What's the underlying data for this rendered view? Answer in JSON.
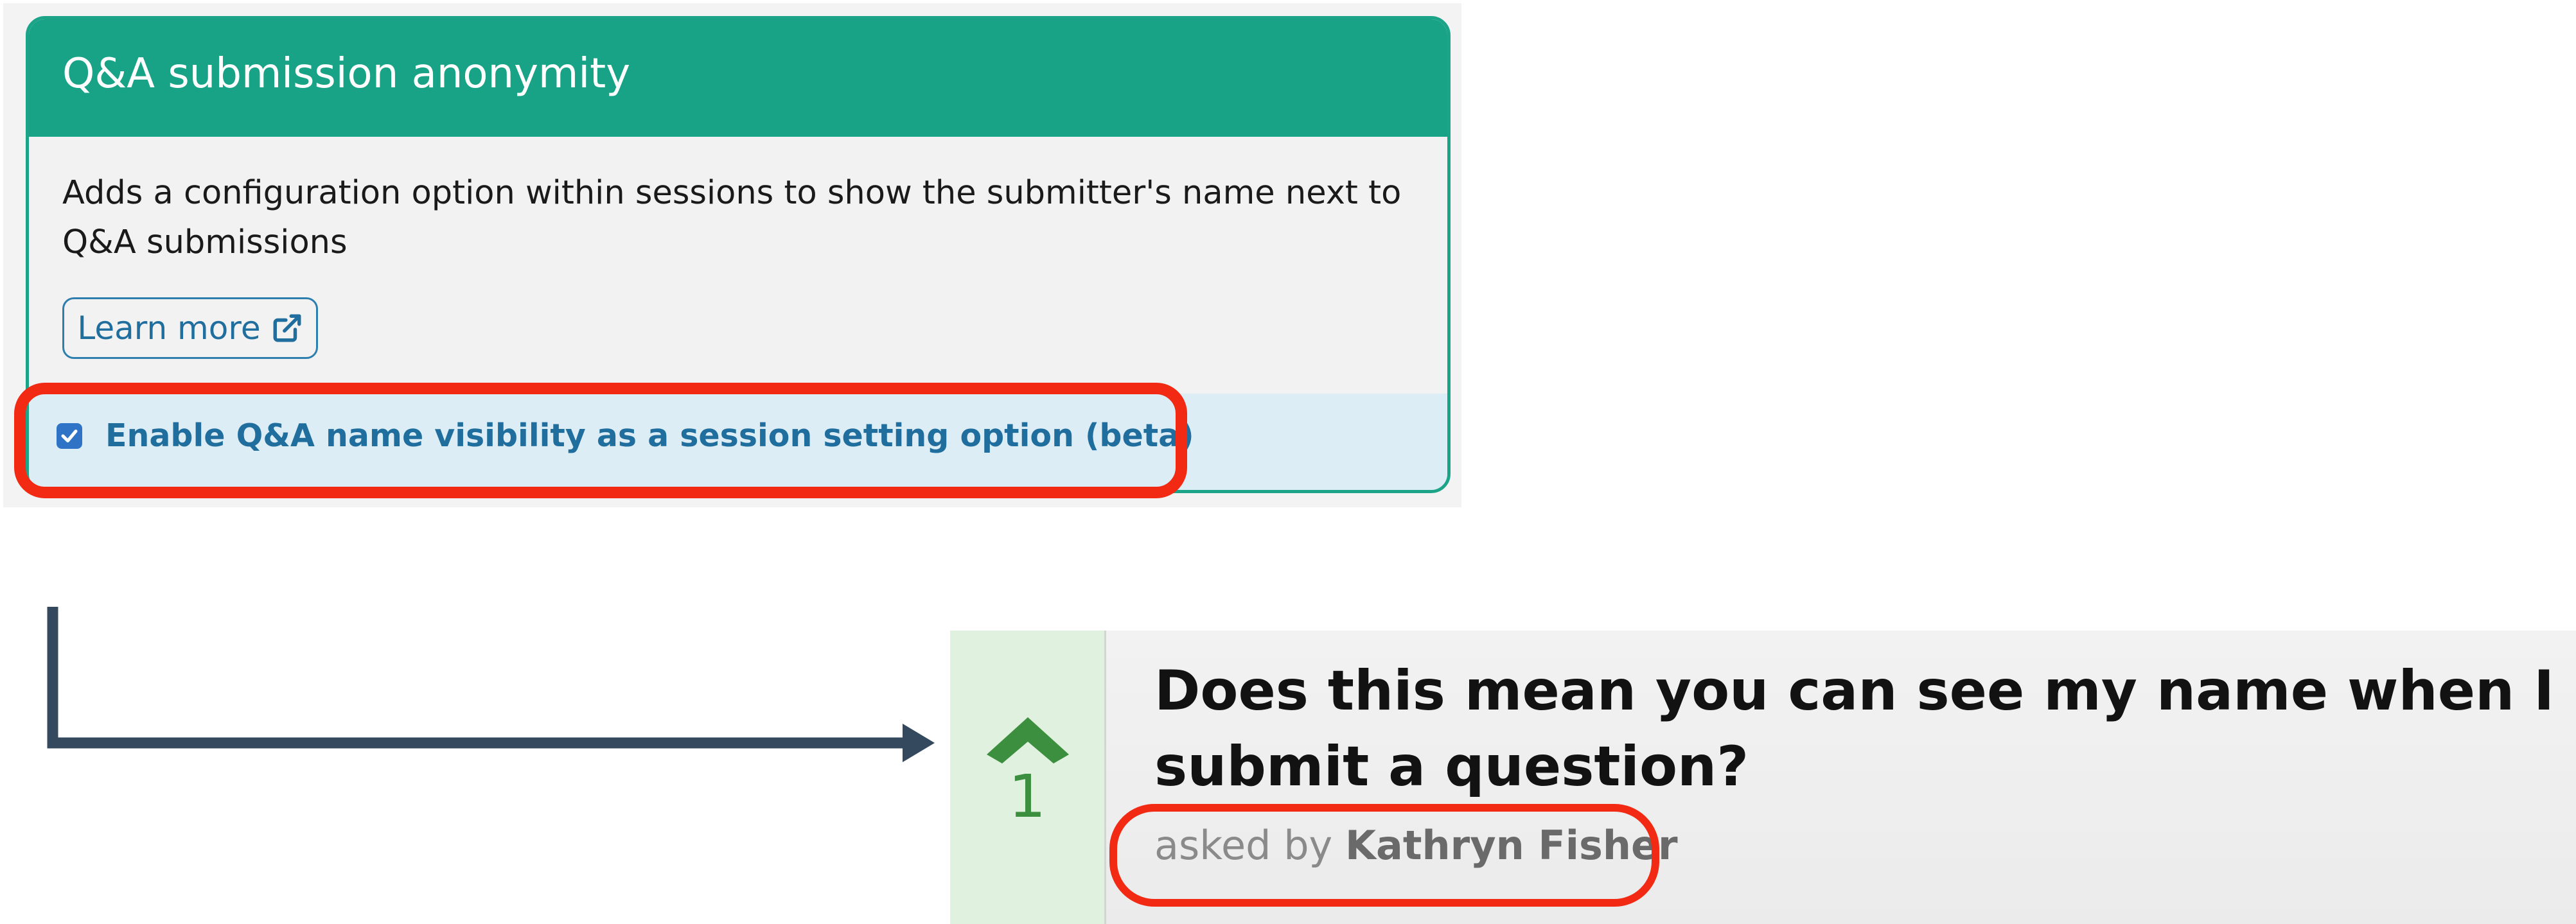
{
  "settings_card": {
    "title": "Q&A submission anonymity",
    "description": "Adds a configuration option within sessions to show the submitter's name next to Q&A submissions",
    "learn_more_label": "Learn more",
    "enable_checked": true,
    "enable_label": "Enable Q&A name visibility as a session setting option (beta)",
    "icons": [
      "external-link-icon",
      "checkbox-check-icon"
    ],
    "colors": {
      "header": "#18a387",
      "link": "#1f6e9e",
      "highlight": "#f22a14"
    }
  },
  "question_card": {
    "vote_count": "1",
    "question": "Does this mean you can see my name when I submit a question?",
    "asked_by_prefix": "asked by",
    "asked_by_name": "Kathryn Fisher",
    "icons": [
      "upvote-chevron-icon"
    ],
    "colors": {
      "vote_accent": "#3b8f3f",
      "vote_bg": "#e1f1df"
    }
  }
}
